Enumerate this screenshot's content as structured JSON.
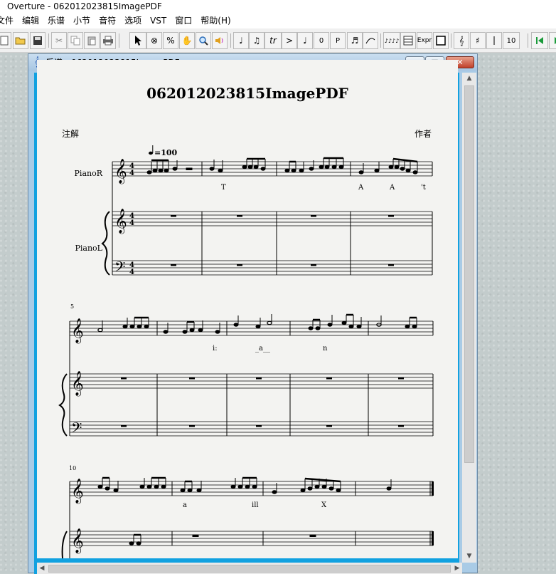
{
  "app": {
    "title": "Overture - 062012023815ImagePDF"
  },
  "menu": [
    "文件",
    "编辑",
    "乐谱",
    "小节",
    "音符",
    "选项",
    "VST",
    "窗口",
    "帮助(H)"
  ],
  "toolbar": {
    "labels": {
      "trill": "tr",
      "accent": ">",
      "zero": "0",
      "p": "P",
      "expr": "Expr",
      "ten": "10"
    }
  },
  "window": {
    "title": "乐谱：062012023815ImagePDF",
    "minimize": "–",
    "maximize": "□",
    "close": "✕"
  },
  "score": {
    "title": "062012023815ImagePDF",
    "left_note": "注解",
    "composer": "作者",
    "tempo": "=100",
    "staff_names": [
      "PianoR",
      "PianoL"
    ],
    "measure_numbers": [
      "5",
      "10"
    ],
    "lyrics_system1": [
      "T",
      "A",
      "A",
      "'t"
    ],
    "lyrics_system2": [
      "i:",
      "_a__",
      "n"
    ],
    "lyrics_system3": [
      "a",
      "ill",
      "X"
    ]
  }
}
